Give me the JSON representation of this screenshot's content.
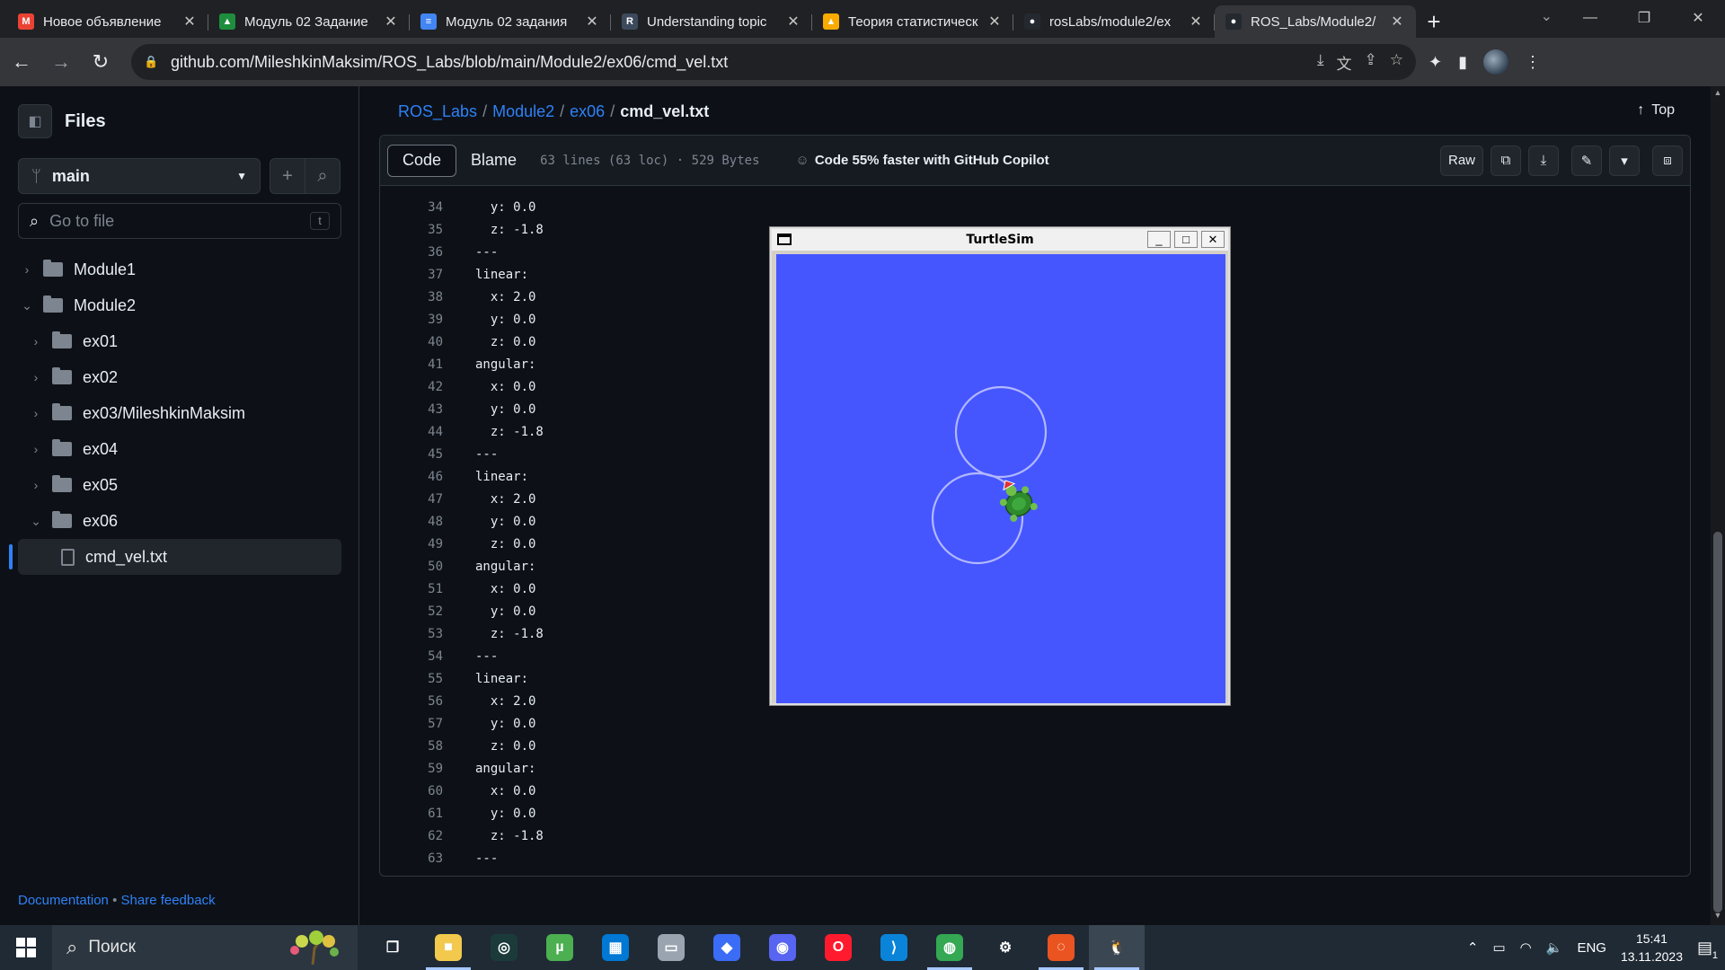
{
  "browser": {
    "tabs": [
      {
        "label": "Новое объявление",
        "icon": "gmail-icon",
        "color": "#ea4335",
        "glyph": "M"
      },
      {
        "label": "Модуль 02 Задание",
        "icon": "classroom-icon",
        "color": "#1e8e3e",
        "glyph": "▲"
      },
      {
        "label": "Модуль 02 задания",
        "icon": "docs-icon",
        "color": "#4285f4",
        "glyph": "≡"
      },
      {
        "label": "Understanding topic",
        "icon": "ros-docs-icon",
        "color": "#3c4a5c",
        "glyph": "R"
      },
      {
        "label": "Теория статистическ",
        "icon": "drive-icon",
        "color": "#f9ab00",
        "glyph": "▲"
      },
      {
        "label": "rosLabs/module2/ex",
        "icon": "github-icon",
        "color": "#24292f",
        "glyph": "●"
      },
      {
        "label": "ROS_Labs/Module2/",
        "icon": "github-icon",
        "color": "#24292f",
        "glyph": "●",
        "active": true
      }
    ],
    "url": "github.com/MileshkinMaksim/ROS_Labs/blob/main/Module2/ex06/cmd_vel.txt"
  },
  "sidebar": {
    "title": "Files",
    "branch": "main",
    "goto_placeholder": "Go to file",
    "goto_shortcut": "t",
    "tree": [
      {
        "label": "Module1",
        "depth": 0,
        "type": "folder",
        "expanded": false
      },
      {
        "label": "Module2",
        "depth": 0,
        "type": "folder",
        "expanded": true
      },
      {
        "label": "ex01",
        "depth": 1,
        "type": "folder",
        "expanded": false
      },
      {
        "label": "ex02",
        "depth": 1,
        "type": "folder",
        "expanded": false
      },
      {
        "label": "ex03/MileshkinMaksim",
        "depth": 1,
        "type": "folder",
        "expanded": false
      },
      {
        "label": "ex04",
        "depth": 1,
        "type": "folder",
        "expanded": false
      },
      {
        "label": "ex05",
        "depth": 1,
        "type": "folder",
        "expanded": false
      },
      {
        "label": "ex06",
        "depth": 1,
        "type": "folder",
        "expanded": true
      },
      {
        "label": "cmd_vel.txt",
        "depth": 2,
        "type": "file",
        "selected": true
      }
    ],
    "footer_docs": "Documentation",
    "footer_sep": "•",
    "footer_feedback": "Share feedback"
  },
  "breadcrumb": {
    "repo": "ROS_Labs",
    "dir1": "Module2",
    "dir2": "ex06",
    "file": "cmd_vel.txt",
    "sep": "/"
  },
  "top_link": "Top",
  "file_header": {
    "code_tab": "Code",
    "blame_tab": "Blame",
    "meta": "63 lines (63 loc) · 529 Bytes",
    "copilot": "Code 55% faster with GitHub Copilot",
    "raw": "Raw"
  },
  "code_lines": [
    {
      "n": "34",
      "t": "  y: 0.0"
    },
    {
      "n": "35",
      "t": "  z: -1.8"
    },
    {
      "n": "36",
      "t": "---"
    },
    {
      "n": "37",
      "t": "linear:"
    },
    {
      "n": "38",
      "t": "  x: 2.0"
    },
    {
      "n": "39",
      "t": "  y: 0.0"
    },
    {
      "n": "40",
      "t": "  z: 0.0"
    },
    {
      "n": "41",
      "t": "angular:"
    },
    {
      "n": "42",
      "t": "  x: 0.0"
    },
    {
      "n": "43",
      "t": "  y: 0.0"
    },
    {
      "n": "44",
      "t": "  z: -1.8"
    },
    {
      "n": "45",
      "t": "---"
    },
    {
      "n": "46",
      "t": "linear:"
    },
    {
      "n": "47",
      "t": "  x: 2.0"
    },
    {
      "n": "48",
      "t": "  y: 0.0"
    },
    {
      "n": "49",
      "t": "  z: 0.0"
    },
    {
      "n": "50",
      "t": "angular:"
    },
    {
      "n": "51",
      "t": "  x: 0.0"
    },
    {
      "n": "52",
      "t": "  y: 0.0"
    },
    {
      "n": "53",
      "t": "  z: -1.8"
    },
    {
      "n": "54",
      "t": "---"
    },
    {
      "n": "55",
      "t": "linear:"
    },
    {
      "n": "56",
      "t": "  x: 2.0"
    },
    {
      "n": "57",
      "t": "  y: 0.0"
    },
    {
      "n": "58",
      "t": "  z: 0.0"
    },
    {
      "n": "59",
      "t": "angular:"
    },
    {
      "n": "60",
      "t": "  x: 0.0"
    },
    {
      "n": "61",
      "t": "  y: 0.0"
    },
    {
      "n": "62",
      "t": "  z: -1.8"
    },
    {
      "n": "63",
      "t": "---"
    }
  ],
  "turtlesim": {
    "title": "TurtleSim",
    "background": "#4556ff",
    "pen_color": "#b3b8ff"
  },
  "taskbar": {
    "search": "Поиск",
    "apps": [
      {
        "icon": "task-view-icon",
        "glyph": "❐",
        "color": "transparent"
      },
      {
        "icon": "file-explorer-icon",
        "glyph": "■",
        "color": "#f2c94c",
        "run": true
      },
      {
        "icon": "app-icon",
        "glyph": "◎",
        "color": "#1b3b3b"
      },
      {
        "icon": "utorrent-icon",
        "glyph": "µ",
        "color": "#4caf50"
      },
      {
        "icon": "store-icon",
        "glyph": "▦",
        "color": "#0078d4"
      },
      {
        "icon": "drive-app-icon",
        "glyph": "▭",
        "color": "#9aa4b0"
      },
      {
        "icon": "copilot-app-icon",
        "glyph": "◆",
        "color": "#3b6cf6"
      },
      {
        "icon": "discord-icon",
        "glyph": "◉",
        "color": "#5865f2"
      },
      {
        "icon": "opera-icon",
        "glyph": "O",
        "color": "#ff1b2d"
      },
      {
        "icon": "vscode-icon",
        "glyph": "⟩",
        "color": "#0a84d8"
      },
      {
        "icon": "chrome-icon",
        "glyph": "◍",
        "color": "#34a853",
        "run": true
      },
      {
        "icon": "settings-icon",
        "glyph": "⚙",
        "color": "transparent"
      },
      {
        "icon": "ubuntu-icon",
        "glyph": "◌",
        "color": "#e95420",
        "run": true
      },
      {
        "icon": "linux-terminal-icon",
        "glyph": "🐧",
        "color": "transparent",
        "run": true,
        "active": true
      }
    ],
    "lang": "ENG",
    "time": "15:41",
    "date": "13.11.2023",
    "notif_count": "1"
  }
}
